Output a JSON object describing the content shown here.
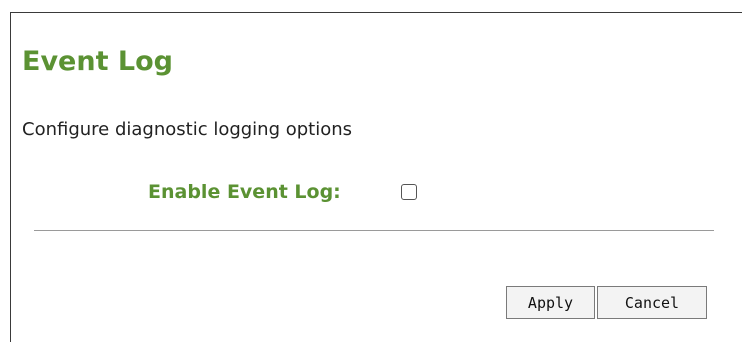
{
  "page": {
    "title": "Event Log",
    "description": "Configure diagnostic logging options"
  },
  "form": {
    "enable_event_log": {
      "label": "Enable Event Log:",
      "checked": false
    }
  },
  "actions": {
    "apply_label": "Apply",
    "cancel_label": "Cancel"
  },
  "colors": {
    "accent": "#5b9233",
    "text": "#222222",
    "divider": "#9a9a9a",
    "button_bg": "#f3f3f3",
    "button_border": "#7a7a7a"
  }
}
